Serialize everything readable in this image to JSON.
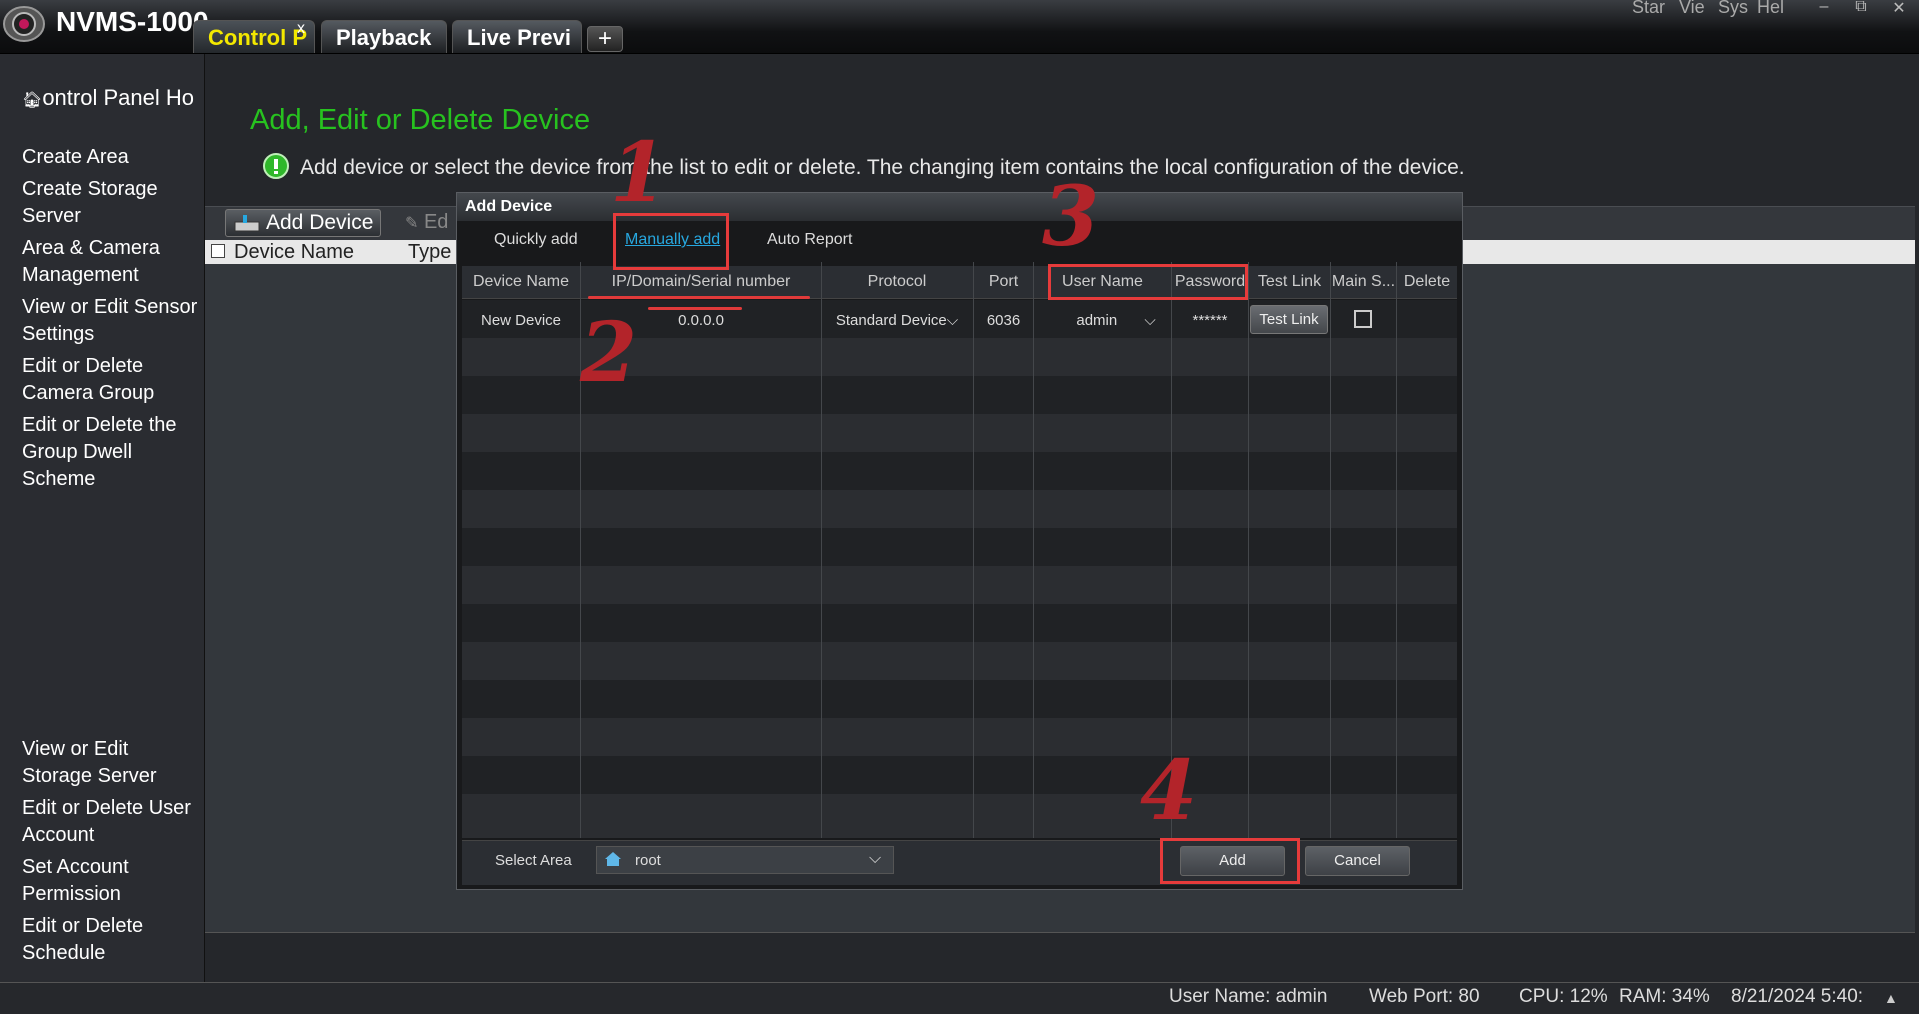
{
  "app": {
    "title": "NVMS-1000",
    "tabs": [
      {
        "label": "Control P",
        "close": "x"
      },
      {
        "label": "Playback"
      },
      {
        "label": "Live Previ"
      }
    ],
    "tab_add": "+",
    "top_menu": [
      "Star",
      "Vie",
      "Sys",
      "Hel"
    ],
    "window_buttons": [
      "–",
      "⧉",
      "✕"
    ]
  },
  "sidebar": {
    "home_label": "ontrol Panel Ho",
    "top_items": [
      "Create Area",
      "Create Storage Server",
      "Area & Camera Management",
      "View or Edit Sensor Settings",
      "Edit or Delete Camera Group",
      "Edit or Delete the Group Dwell Scheme"
    ],
    "bottom_items": [
      "View or Edit Storage Server",
      "Edit or Delete User Account",
      "Set Account Permission",
      "Edit or Delete Schedule"
    ]
  },
  "main": {
    "title": "Add, Edit or Delete Device",
    "description": "Add device or select the device from the list to edit or delete. The changing item contains the local configuration of the device.",
    "toolbar": {
      "add_device": "Add Device",
      "edit": "Ed"
    },
    "columns": [
      "Device Name",
      "Type"
    ]
  },
  "modal": {
    "title": "Add Device",
    "tabs": [
      "Quickly add",
      "Manually add",
      "Auto Report"
    ],
    "columns": [
      "Device Name",
      "IP/Domain/Serial number",
      "Protocol",
      "Port",
      "User Name",
      "Password",
      "Test Link",
      "Main S...",
      "Delete"
    ],
    "row": {
      "device_name": "New Device",
      "ip": "0.0.0.0",
      "protocol": "Standard Device",
      "port": "6036",
      "user_name": "admin",
      "password": "******",
      "test_link": "Test Link"
    },
    "footer": {
      "select_area_label": "Select Area",
      "area_value": "root",
      "add": "Add",
      "cancel": "Cancel"
    }
  },
  "annotations": [
    "1",
    "2",
    "3",
    "4"
  ],
  "status_bar": {
    "user": "User Name: admin",
    "port": "Web Port: 80",
    "cpu": "CPU: 12%",
    "ram": "RAM: 34%",
    "datetime": "8/21/2024 5:40:"
  },
  "colors": {
    "accent_green": "#27c21f",
    "active_tab": "#f3e800",
    "link_blue": "#27a8e0",
    "annotation_red": "#e63b3b"
  }
}
